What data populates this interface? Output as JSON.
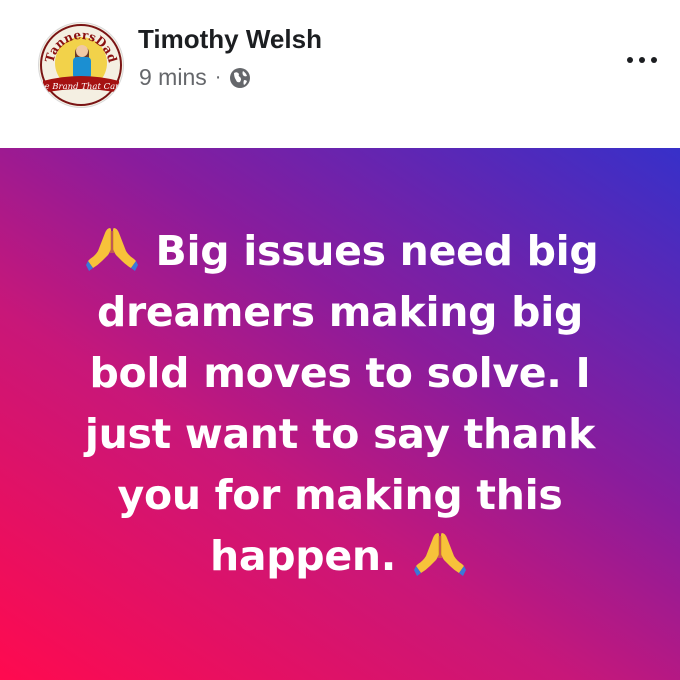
{
  "author": {
    "name": "Timothy Welsh",
    "timestamp": "9 mins",
    "separator": "·",
    "privacy_icon": "globe-icon",
    "avatar": {
      "arc_text": "TannersDad",
      "banner_text": "The Brand That Cares"
    }
  },
  "menu": {
    "icon": "more-options-icon"
  },
  "post": {
    "lines": [
      "Big issues need big",
      "dreamers making big",
      "bold moves to solve. I",
      "just want to say thank",
      "you for making this",
      "happen."
    ],
    "emoji": "folded-hands-icon",
    "background_gradient": [
      "#ff0a4f",
      "#c81779",
      "#8a1c9c",
      "#3730c9"
    ]
  },
  "colors": {
    "name": "#1c1e21",
    "meta": "#65676b",
    "post_text": "#ffffff"
  }
}
